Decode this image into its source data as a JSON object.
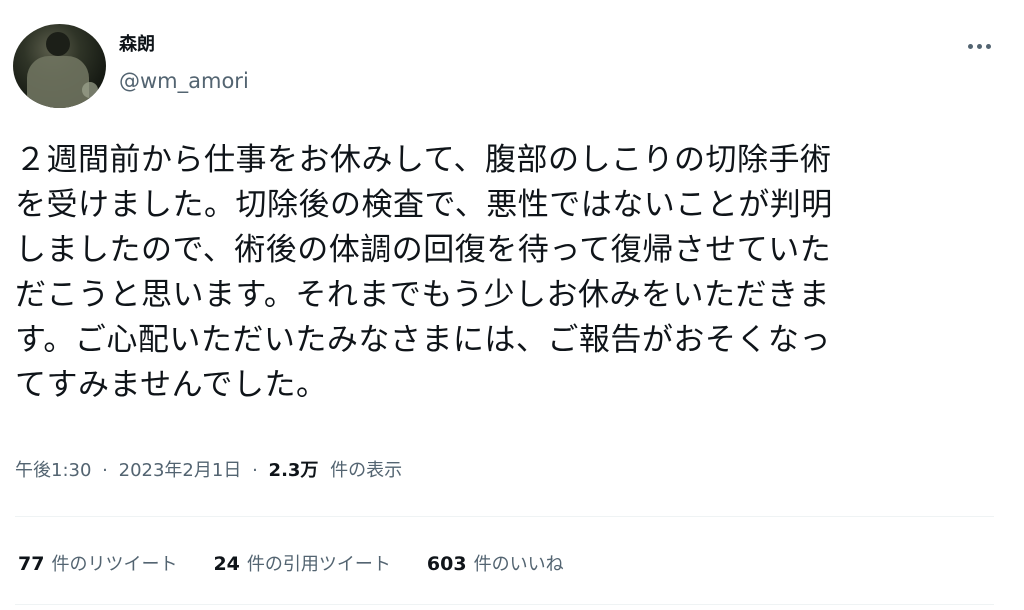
{
  "author": {
    "display_name": "森朗",
    "handle": "@wm_amori"
  },
  "tweet": {
    "text": "２週間前から仕事をお休みして、腹部のしこりの切除手術\nを受けました。切除後の検査で、悪性ではないことが判明\nしましたので、術後の体調の回復を待って復帰させていた\nだこうと思います。それまでもう少しお休みをいただきま\nす。ご心配いただいたみなさまには、ご報告がおそくなっ\nてすみませんでした。",
    "time": "午後1:30",
    "date": "2023年2月1日",
    "separator": "·",
    "views_count": "2.3万",
    "views_label": "件の表示"
  },
  "stats": {
    "retweets_count": "77",
    "retweets_label": "件のリツイート",
    "quotes_count": "24",
    "quotes_label": "件の引用ツイート",
    "likes_count": "603",
    "likes_label": "件のいいね"
  },
  "icons": {
    "more": "more-horizontal-icon"
  },
  "colors": {
    "text_primary": "#0f1419",
    "text_secondary": "#536471",
    "divider": "#eff3f4",
    "background": "#ffffff"
  }
}
